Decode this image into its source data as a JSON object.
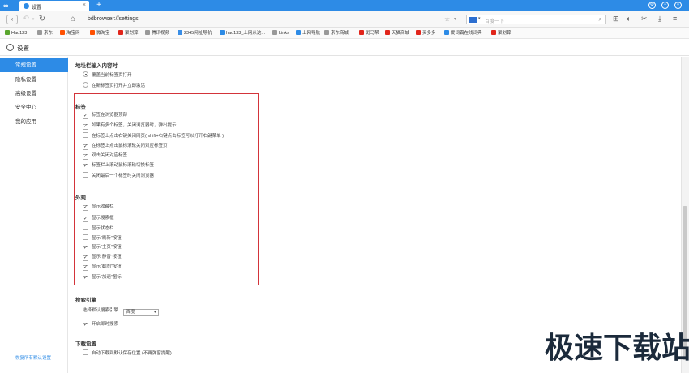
{
  "tab": {
    "title": "设置",
    "close": "×",
    "new_tab": "+"
  },
  "window": {
    "settings": "⚙",
    "minimize": "−",
    "close": "×"
  },
  "address": {
    "url": "bdbrowser://settings",
    "search_placeholder": "百度一下"
  },
  "bookmarks": [
    {
      "label": "Hao123",
      "color": "#59a52c"
    },
    {
      "label": "京东",
      "color": "#999999"
    },
    {
      "label": "淘宝网",
      "color": "#ff5000"
    },
    {
      "label": "微淘宝",
      "color": "#ff5000"
    },
    {
      "label": "聚划算",
      "color": "#e1251b"
    },
    {
      "label": "腾讯视频",
      "color": "#999999"
    },
    {
      "label": "2345网址导航",
      "color": "#3a8ee6"
    },
    {
      "label": "hao123_上网从这...",
      "color": "#2d8be6"
    },
    {
      "label": "Links",
      "color": "#999999"
    },
    {
      "label": "上网导航",
      "color": "#2d8be6"
    },
    {
      "label": "京东商城",
      "color": "#999999"
    },
    {
      "label": "斑马帮",
      "color": "#e1251b"
    },
    {
      "label": "天猫商城",
      "color": "#e1251b"
    },
    {
      "label": "买多多",
      "color": "#e1251b"
    },
    {
      "label": "爱词霸在线词典",
      "color": "#2d8be6"
    },
    {
      "label": "聚划算",
      "color": "#e1251b"
    }
  ],
  "page": {
    "title": "设置"
  },
  "sidebar": {
    "items": [
      "常规设置",
      "隐私设置",
      "高级设置",
      "安全中心",
      "我的应用"
    ],
    "restore": "恢复所有默认设置"
  },
  "sections": {
    "address_input": {
      "title": "地址栏输入内容时",
      "options": [
        {
          "label": "覆盖当前标签页打开",
          "selected": true
        },
        {
          "label": "在新标签页打开并立即激活",
          "selected": false
        }
      ]
    },
    "tabs": {
      "title": "标签",
      "options": [
        {
          "label": "标签在浏览器顶部",
          "checked": true
        },
        {
          "label": "如果有多个标签，关闭浏览器时，弹出提示",
          "checked": true
        },
        {
          "label": "在标签上点击右键关闭网页( shift+右键点击标签可以打开右键菜单 )",
          "checked": false
        },
        {
          "label": "在标签上点击鼠标滚轮关闭对应标签页",
          "checked": true
        },
        {
          "label": "双击关闭对应标签",
          "checked": true
        },
        {
          "label": "标签栏上滚动鼠标滚轮切换标签",
          "checked": true
        },
        {
          "label": "关闭最后一个标签时关闭浏览器",
          "checked": false
        }
      ]
    },
    "appearance": {
      "title": "外观",
      "options": [
        {
          "label": "显示收藏栏",
          "checked": true
        },
        {
          "label": "显示搜索框",
          "checked": true
        },
        {
          "label": "显示状态栏",
          "checked": false
        },
        {
          "label": "显示“刷新”按钮",
          "checked": false
        },
        {
          "label": "显示“主页”按钮",
          "checked": true
        },
        {
          "label": "显示“静音”按钮",
          "checked": true
        },
        {
          "label": "显示“截图”按钮",
          "checked": true
        },
        {
          "label": "显示“加速”图标",
          "checked": true
        }
      ]
    },
    "search": {
      "title": "搜索引擎",
      "engine_label": "选择默认搜索引擎",
      "engine_value": "百度",
      "instant": {
        "label": "开启即时搜索",
        "checked": true
      }
    },
    "download": {
      "title": "下载设置",
      "option": {
        "label": "自动下载到默认保存位置 (不再弹窗提醒)",
        "checked": false
      }
    }
  },
  "watermark": "极速下载站",
  "colors": {
    "accent": "#2d8be6",
    "highlight_border": "#d3343a"
  }
}
